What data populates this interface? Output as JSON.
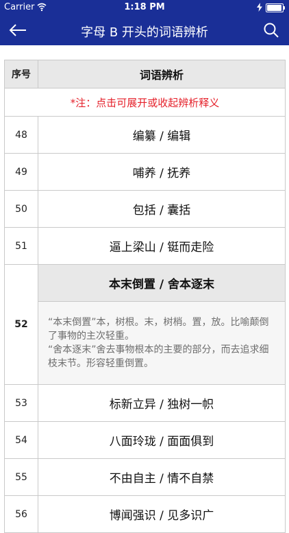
{
  "status_bar": {
    "carrier": "Carrier",
    "time": "1:18 PM"
  },
  "nav": {
    "title": "字母 B 开头的词语辨析",
    "back_icon": "arrow-left-icon",
    "search_icon": "search-icon"
  },
  "table": {
    "header_num": "序号",
    "header_text": "词语辨析",
    "note": "*注：点击可展开或收起辨析释义",
    "rows_before": [
      {
        "num": "48",
        "text": "编纂 / 编辑"
      },
      {
        "num": "49",
        "text": "哺养 / 抚养"
      },
      {
        "num": "50",
        "text": "包括 / 囊括"
      },
      {
        "num": "51",
        "text": "逼上梁山 / 铤而走险"
      }
    ],
    "expanded": {
      "num": "52",
      "title": "本末倒置 / 舍本逐末",
      "explanation_1": "“本末倒置”本，树根。末，树梢。置，放。比喻颠倒了事物的主次轻重。",
      "explanation_2": "“舍本逐末”舍去事物根本的主要的部分，而去追求细枝末节。形容轻重倒置。"
    },
    "rows_after": [
      {
        "num": "53",
        "text": "标新立异 / 独树一帜"
      },
      {
        "num": "54",
        "text": "八面玲珑 / 面面俱到"
      },
      {
        "num": "55",
        "text": "不由自主 / 情不自禁"
      },
      {
        "num": "56",
        "text": "博闻强识 / 见多识广"
      }
    ]
  }
}
